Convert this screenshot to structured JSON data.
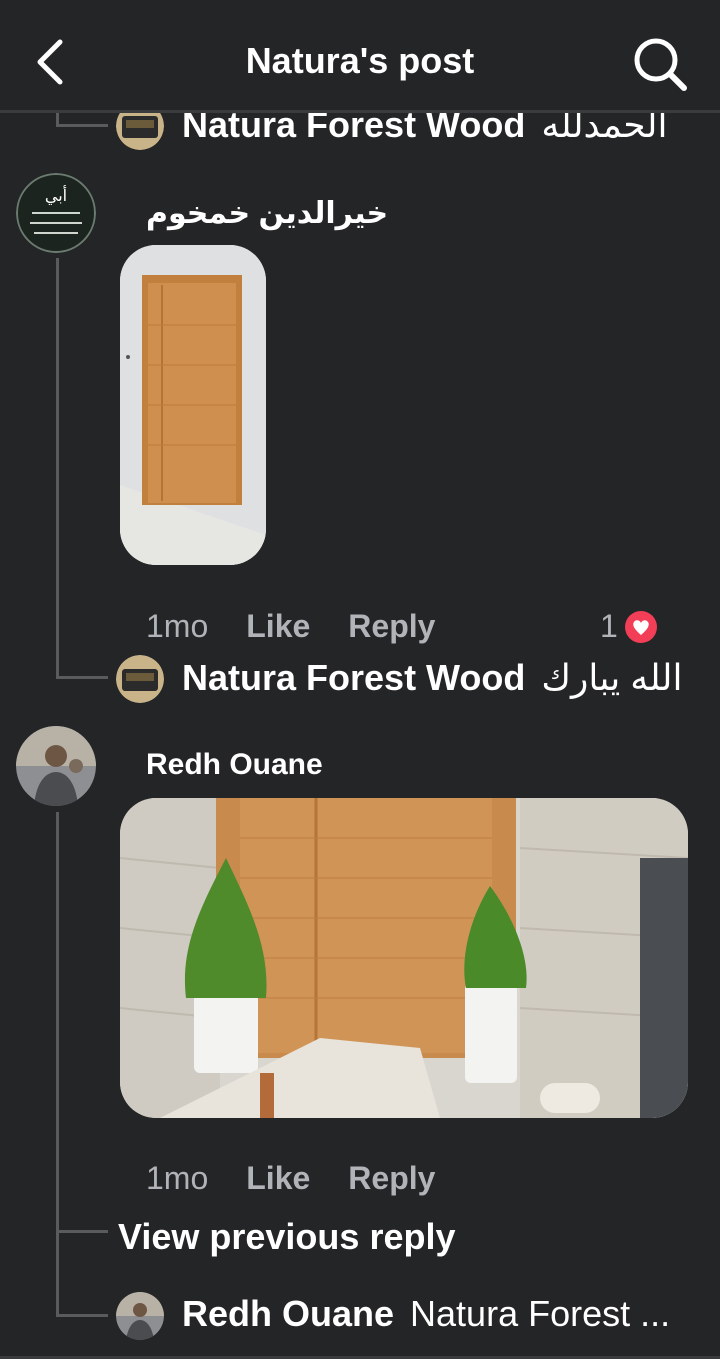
{
  "header": {
    "title": "Natura's post",
    "back_icon": "chevron-left-icon",
    "search_icon": "search-icon"
  },
  "thread": {
    "top_reply": {
      "author": "Natura Forest Wood",
      "text": "الحمدلله"
    },
    "comment1": {
      "author": "خيرالدين خمخوم",
      "avatar_text": "أبي",
      "time": "1mo",
      "like_label": "Like",
      "reply_label": "Reply",
      "reaction_count": "1",
      "reaction_icon": "heart-reaction-icon",
      "reply": {
        "author": "Natura Forest Wood",
        "text": "الله يبارك"
      }
    },
    "comment2": {
      "author": "Redh Ouane",
      "time": "1mo",
      "like_label": "Like",
      "reply_label": "Reply",
      "view_previous": "View previous reply",
      "reply": {
        "author": "Redh Ouane",
        "text": "Natura Forest ..."
      }
    }
  },
  "colors": {
    "background": "#242526",
    "divider": "#3a3b3c",
    "text_primary": "#ffffff",
    "text_secondary": "#b0b3b8",
    "reaction_red": "#f33e58"
  }
}
